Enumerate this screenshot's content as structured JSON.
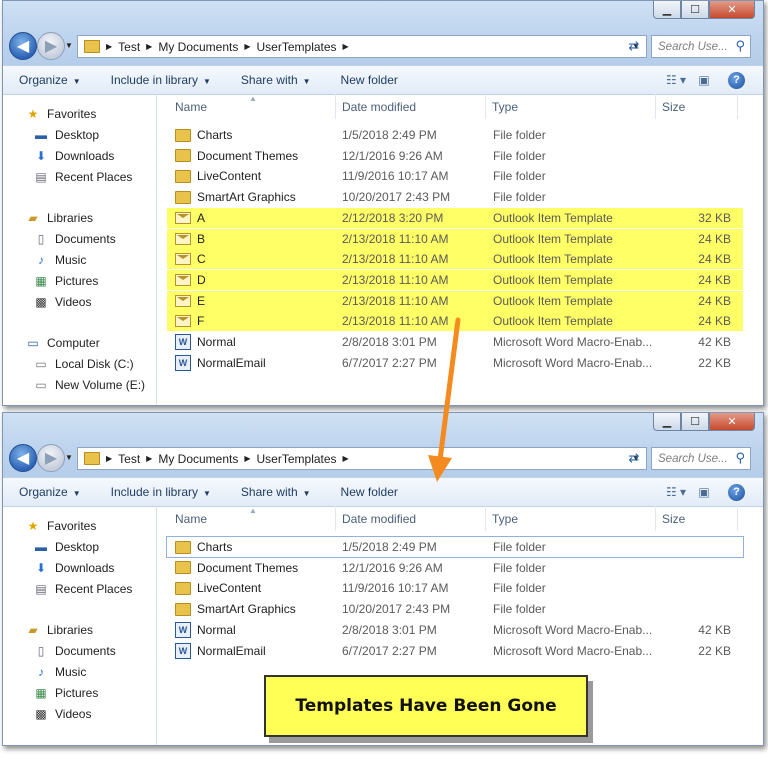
{
  "address": {
    "crumbs": [
      "Test",
      "My Documents",
      "UserTemplates"
    ],
    "search_placeholder": "Search Use..."
  },
  "toolbar": {
    "organize": "Organize",
    "include_in_library": "Include in library",
    "share_with": "Share with",
    "new_folder": "New folder"
  },
  "nav": {
    "favorites": "Favorites",
    "desktop": "Desktop",
    "downloads": "Downloads",
    "recent_places": "Recent Places",
    "libraries": "Libraries",
    "documents": "Documents",
    "music": "Music",
    "pictures": "Pictures",
    "videos": "Videos",
    "computer": "Computer",
    "local_disk": "Local Disk (C:)",
    "new_volume": "New Volume (E:)"
  },
  "columns": {
    "name": "Name",
    "date_modified": "Date modified",
    "type": "Type",
    "size": "Size"
  },
  "before_files": [
    {
      "name": "Charts",
      "date": "1/5/2018 2:49 PM",
      "type": "File folder",
      "size": "",
      "icon": "folder-icon",
      "highlight": false
    },
    {
      "name": "Document Themes",
      "date": "12/1/2016 9:26 AM",
      "type": "File folder",
      "size": "",
      "icon": "folder-icon",
      "highlight": false
    },
    {
      "name": "LiveContent",
      "date": "11/9/2016 10:17 AM",
      "type": "File folder",
      "size": "",
      "icon": "folder-icon",
      "highlight": false
    },
    {
      "name": "SmartArt Graphics",
      "date": "10/20/2017 2:43 PM",
      "type": "File folder",
      "size": "",
      "icon": "folder-icon",
      "highlight": false
    },
    {
      "name": "A",
      "date": "2/12/2018 3:20 PM",
      "type": "Outlook Item Template",
      "size": "32 KB",
      "icon": "mail-template-icon",
      "highlight": true
    },
    {
      "name": "B",
      "date": "2/13/2018 11:10 AM",
      "type": "Outlook Item Template",
      "size": "24 KB",
      "icon": "mail-template-icon",
      "highlight": true
    },
    {
      "name": "C",
      "date": "2/13/2018 11:10 AM",
      "type": "Outlook Item Template",
      "size": "24 KB",
      "icon": "mail-template-icon",
      "highlight": true
    },
    {
      "name": "D",
      "date": "2/13/2018 11:10 AM",
      "type": "Outlook Item Template",
      "size": "24 KB",
      "icon": "mail-template-icon",
      "highlight": true
    },
    {
      "name": "E",
      "date": "2/13/2018 11:10 AM",
      "type": "Outlook Item Template",
      "size": "24 KB",
      "icon": "mail-template-icon",
      "highlight": true
    },
    {
      "name": "F",
      "date": "2/13/2018 11:10 AM",
      "type": "Outlook Item Template",
      "size": "24 KB",
      "icon": "mail-template-icon",
      "highlight": true
    },
    {
      "name": "Normal",
      "date": "2/8/2018 3:01 PM",
      "type": "Microsoft Word Macro-Enab...",
      "size": "42 KB",
      "icon": "word-doc-icon",
      "highlight": false
    },
    {
      "name": "NormalEmail",
      "date": "6/7/2017 2:27 PM",
      "type": "Microsoft Word Macro-Enab...",
      "size": "22 KB",
      "icon": "word-doc-icon",
      "highlight": false
    }
  ],
  "after_files": [
    {
      "name": "Charts",
      "date": "1/5/2018 2:49 PM",
      "type": "File folder",
      "size": "",
      "icon": "folder-icon",
      "selected": true
    },
    {
      "name": "Document Themes",
      "date": "12/1/2016 9:26 AM",
      "type": "File folder",
      "size": "",
      "icon": "folder-icon",
      "selected": false
    },
    {
      "name": "LiveContent",
      "date": "11/9/2016 10:17 AM",
      "type": "File folder",
      "size": "",
      "icon": "folder-icon",
      "selected": false
    },
    {
      "name": "SmartArt Graphics",
      "date": "10/20/2017 2:43 PM",
      "type": "File folder",
      "size": "",
      "icon": "folder-icon",
      "selected": false
    },
    {
      "name": "Normal",
      "date": "2/8/2018 3:01 PM",
      "type": "Microsoft Word Macro-Enab...",
      "size": "42 KB",
      "icon": "word-doc-icon",
      "selected": false
    },
    {
      "name": "NormalEmail",
      "date": "6/7/2017 2:27 PM",
      "type": "Microsoft Word Macro-Enab...",
      "size": "22 KB",
      "icon": "word-doc-icon",
      "selected": false
    }
  ],
  "callout": "Templates Have Been Gone",
  "colors": {
    "highlight": "#ffff66",
    "callout_bg": "#ffff55",
    "arrow": "#f58a1f"
  }
}
